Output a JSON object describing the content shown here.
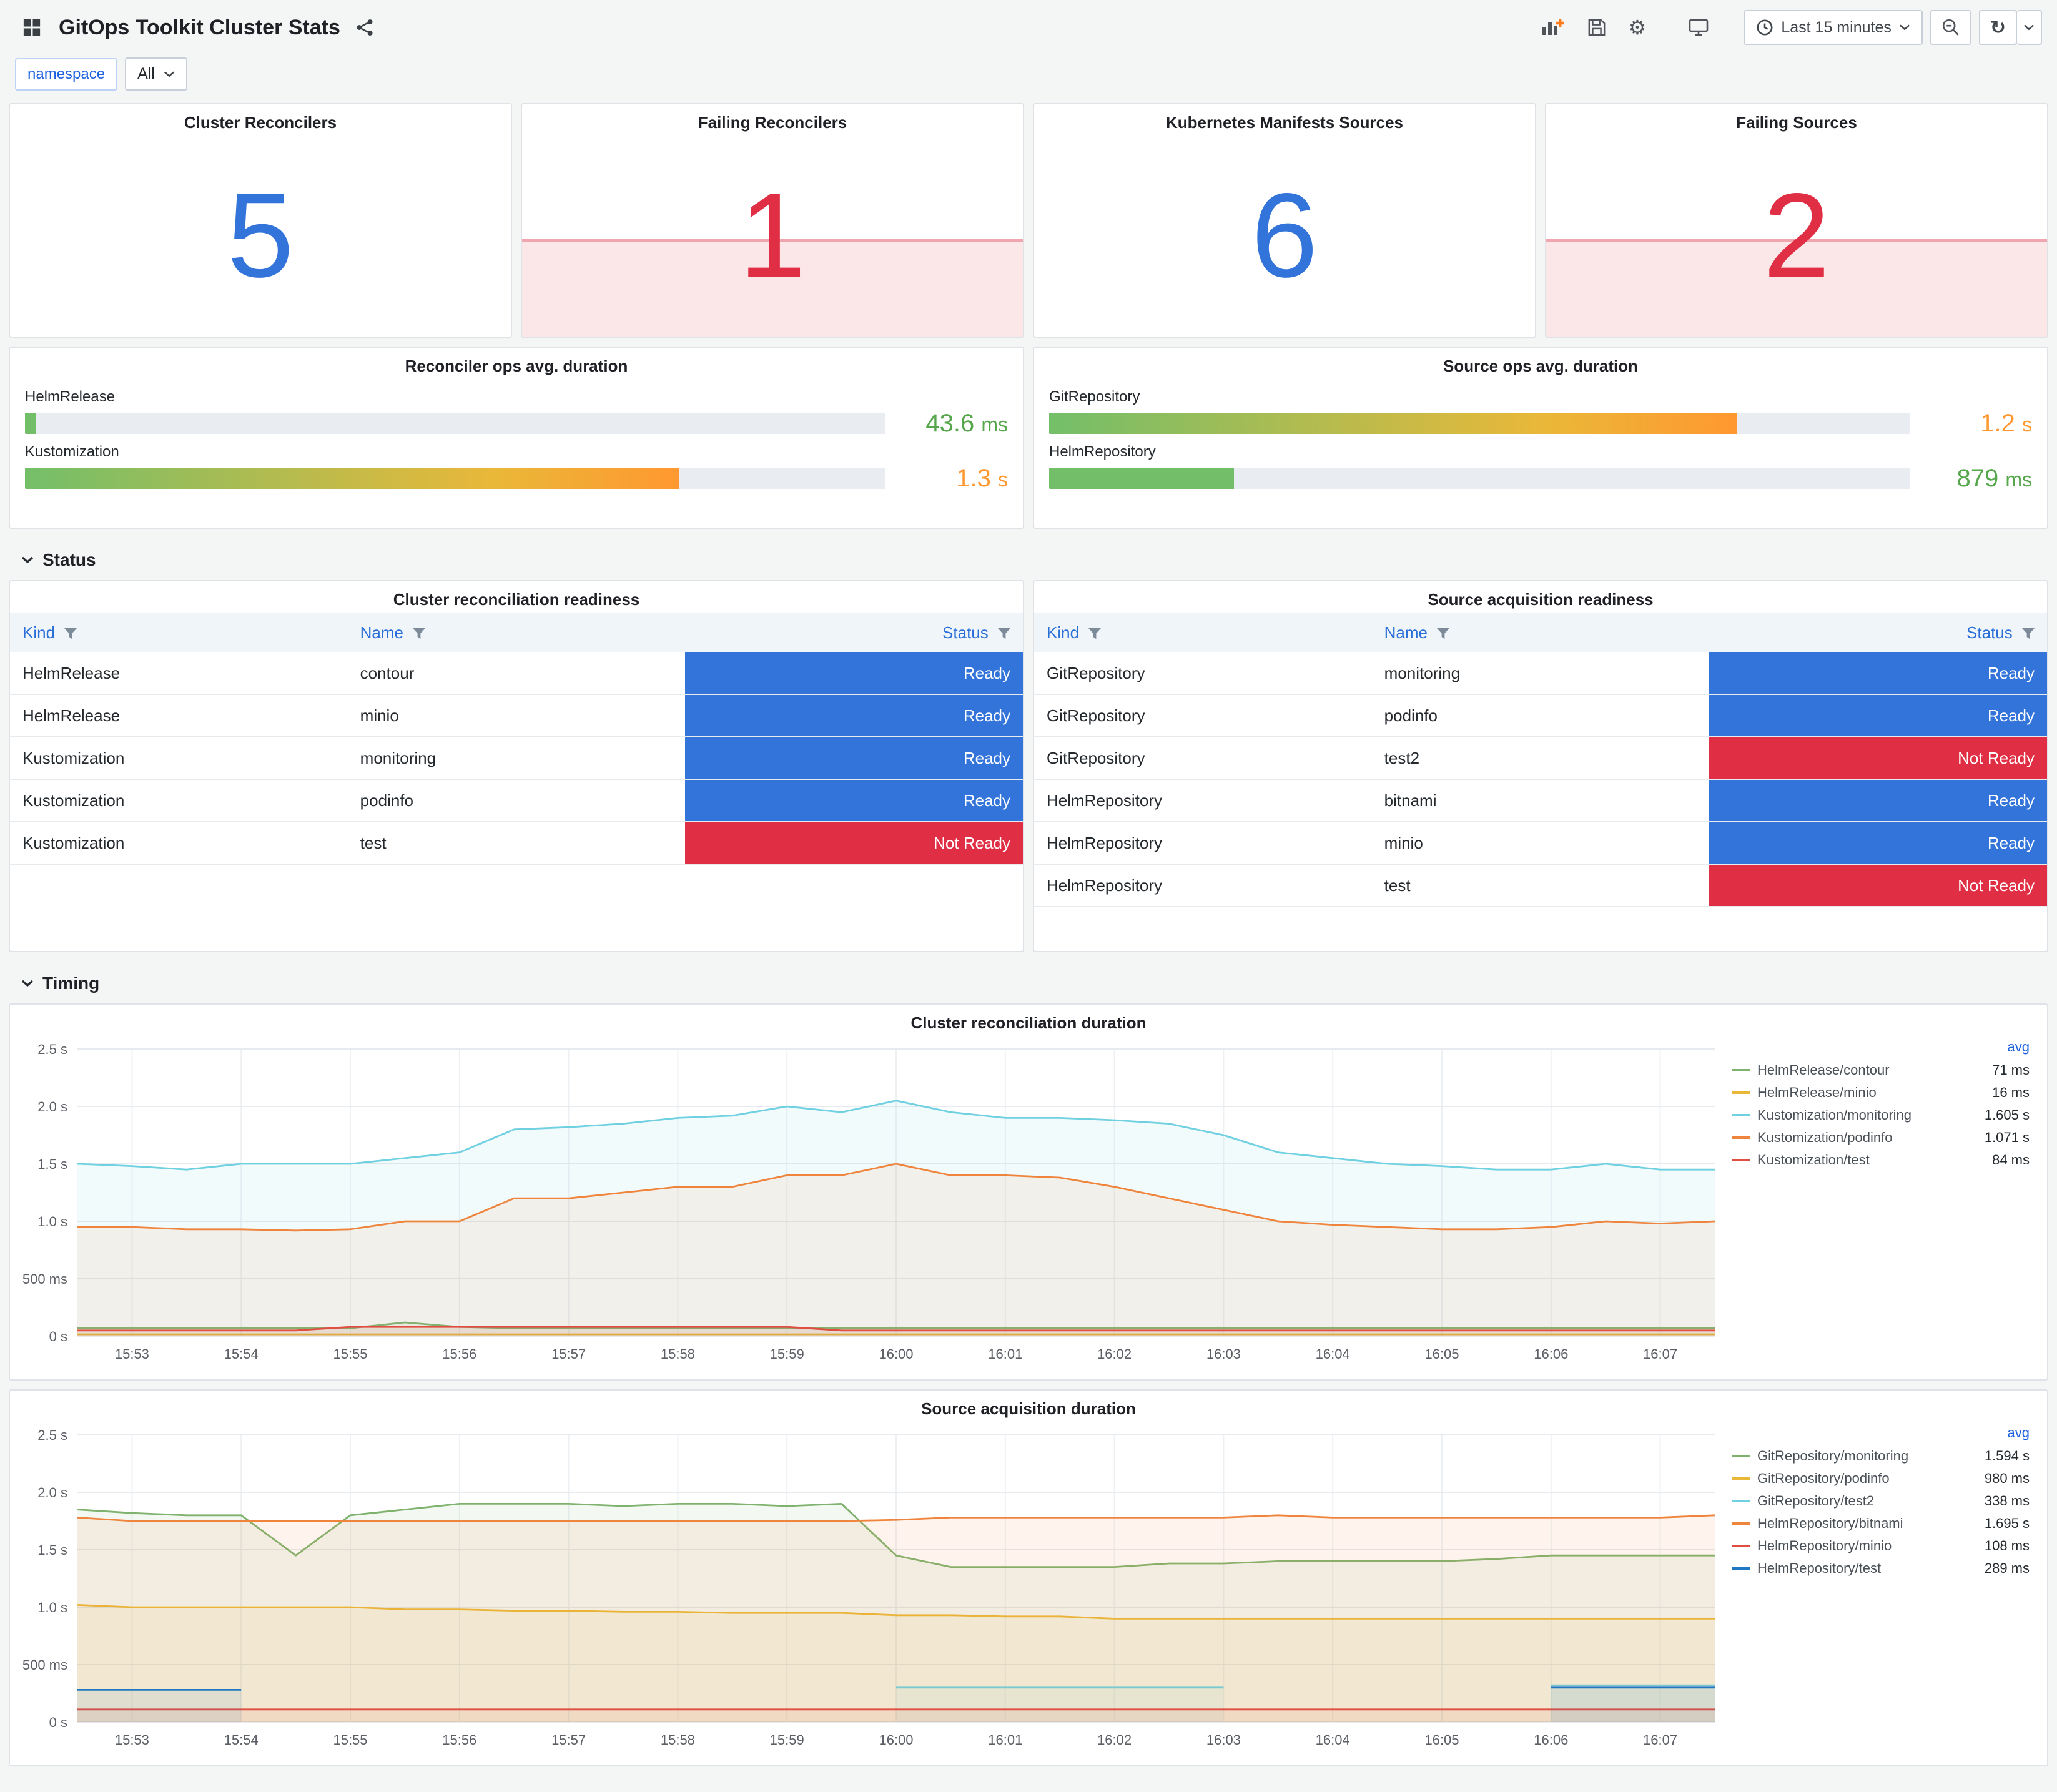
{
  "header": {
    "title": "GitOps Toolkit Cluster Stats",
    "time_range": "Last 15 minutes"
  },
  "filters": {
    "namespace_label": "namespace",
    "namespace_value": "All"
  },
  "sections": {
    "status": "Status",
    "timing": "Timing"
  },
  "stats": [
    {
      "title": "Cluster Reconcilers",
      "value": "5",
      "state": "ok"
    },
    {
      "title": "Failing Reconcilers",
      "value": "1",
      "state": "alert"
    },
    {
      "title": "Kubernetes Manifests Sources",
      "value": "6",
      "state": "ok"
    },
    {
      "title": "Failing Sources",
      "value": "2",
      "state": "alert"
    }
  ],
  "gauges": [
    {
      "title": "Reconciler ops avg. duration",
      "bars": [
        {
          "label": "HelmRelease",
          "value": "43.6",
          "unit": "ms",
          "fraction": 0.013,
          "color": "green"
        },
        {
          "label": "Kustomization",
          "value": "1.3",
          "unit": "s",
          "fraction": 0.76,
          "color": "orange"
        }
      ]
    },
    {
      "title": "Source ops avg. duration",
      "bars": [
        {
          "label": "GitRepository",
          "value": "1.2",
          "unit": "s",
          "fraction": 0.8,
          "color": "orange"
        },
        {
          "label": "HelmRepository",
          "value": "879",
          "unit": "ms",
          "fraction": 0.215,
          "color": "green"
        }
      ]
    }
  ],
  "tables": [
    {
      "title": "Cluster reconciliation readiness",
      "columns": [
        "Kind",
        "Name",
        "Status"
      ],
      "rows": [
        [
          "HelmRelease",
          "contour",
          "Ready"
        ],
        [
          "HelmRelease",
          "minio",
          "Ready"
        ],
        [
          "Kustomization",
          "monitoring",
          "Ready"
        ],
        [
          "Kustomization",
          "podinfo",
          "Ready"
        ],
        [
          "Kustomization",
          "test",
          "Not Ready"
        ]
      ]
    },
    {
      "title": "Source acquisition readiness",
      "columns": [
        "Kind",
        "Name",
        "Status"
      ],
      "rows": [
        [
          "GitRepository",
          "monitoring",
          "Ready"
        ],
        [
          "GitRepository",
          "podinfo",
          "Ready"
        ],
        [
          "GitRepository",
          "test2",
          "Not Ready"
        ],
        [
          "HelmRepository",
          "bitnami",
          "Ready"
        ],
        [
          "HelmRepository",
          "minio",
          "Ready"
        ],
        [
          "HelmRepository",
          "test",
          "Not Ready"
        ]
      ]
    }
  ],
  "chart_data": [
    {
      "type": "line",
      "title": "Cluster reconciliation duration",
      "legend_header": "avg",
      "ylim": [
        0,
        2.5
      ],
      "yticks": [
        {
          "v": 0,
          "label": "0 s"
        },
        {
          "v": 0.5,
          "label": "500 ms"
        },
        {
          "v": 1.0,
          "label": "1.0 s"
        },
        {
          "v": 1.5,
          "label": "1.5 s"
        },
        {
          "v": 2.0,
          "label": "2.0 s"
        },
        {
          "v": 2.5,
          "label": "2.5 s"
        }
      ],
      "x": [
        "15:53",
        "15:54",
        "15:55",
        "15:56",
        "15:57",
        "15:58",
        "15:59",
        "16:00",
        "16:01",
        "16:02",
        "16:03",
        "16:04",
        "16:05",
        "16:06",
        "16:07"
      ],
      "series": [
        {
          "name": "HelmRelease/contour",
          "avg": "71 ms",
          "color": "#7EB26D",
          "values": [
            0.07,
            0.07,
            0.07,
            0.07,
            0.07,
            0.07,
            0.12,
            0.08,
            0.07,
            0.07,
            0.07,
            0.07,
            0.07,
            0.07,
            0.07,
            0.07,
            0.07,
            0.07,
            0.07,
            0.07,
            0.07,
            0.07,
            0.07,
            0.07,
            0.07,
            0.07,
            0.07,
            0.07,
            0.07,
            0.07,
            0.07
          ]
        },
        {
          "name": "HelmRelease/minio",
          "avg": "16 ms",
          "color": "#EAB839",
          "values": [
            0.016,
            0.016,
            0.016,
            0.016,
            0.016,
            0.016,
            0.016,
            0.016,
            0.016,
            0.016,
            0.016,
            0.016,
            0.016,
            0.016,
            0.016,
            0.016,
            0.016,
            0.016,
            0.016,
            0.016,
            0.016,
            0.016,
            0.016,
            0.016,
            0.016,
            0.016,
            0.016,
            0.016,
            0.016,
            0.016,
            0.016
          ]
        },
        {
          "name": "Kustomization/monitoring",
          "avg": "1.605 s",
          "color": "#6ED0E0",
          "values": [
            1.5,
            1.48,
            1.45,
            1.5,
            1.5,
            1.5,
            1.55,
            1.6,
            1.8,
            1.82,
            1.85,
            1.9,
            1.92,
            2.0,
            1.95,
            2.05,
            1.95,
            1.9,
            1.9,
            1.88,
            1.85,
            1.75,
            1.6,
            1.55,
            1.5,
            1.48,
            1.45,
            1.45,
            1.5,
            1.45,
            1.45
          ]
        },
        {
          "name": "Kustomization/podinfo",
          "avg": "1.071 s",
          "color": "#EF843C",
          "values": [
            0.95,
            0.95,
            0.93,
            0.93,
            0.92,
            0.93,
            1.0,
            1.0,
            1.2,
            1.2,
            1.25,
            1.3,
            1.3,
            1.4,
            1.4,
            1.5,
            1.4,
            1.4,
            1.38,
            1.3,
            1.2,
            1.1,
            1.0,
            0.97,
            0.95,
            0.93,
            0.93,
            0.95,
            1.0,
            0.98,
            1.0
          ]
        },
        {
          "name": "Kustomization/test",
          "avg": "84 ms",
          "color": "#E24D42",
          "values": [
            0.05,
            0.05,
            0.05,
            0.05,
            0.05,
            0.08,
            0.08,
            0.08,
            0.08,
            0.08,
            0.08,
            0.08,
            0.08,
            0.08,
            0.05,
            0.05,
            0.05,
            0.05,
            0.05,
            0.05,
            0.05,
            0.05,
            0.05,
            0.05,
            0.05,
            0.05,
            0.05,
            0.05,
            0.05,
            0.05,
            0.05
          ]
        }
      ]
    },
    {
      "type": "line",
      "title": "Source acquisition duration",
      "legend_header": "avg",
      "ylim": [
        0,
        2.5
      ],
      "yticks": [
        {
          "v": 0,
          "label": "0 s"
        },
        {
          "v": 0.5,
          "label": "500 ms"
        },
        {
          "v": 1.0,
          "label": "1.0 s"
        },
        {
          "v": 1.5,
          "label": "1.5 s"
        },
        {
          "v": 2.0,
          "label": "2.0 s"
        },
        {
          "v": 2.5,
          "label": "2.5 s"
        }
      ],
      "x": [
        "15:53",
        "15:54",
        "15:55",
        "15:56",
        "15:57",
        "15:58",
        "15:59",
        "16:00",
        "16:01",
        "16:02",
        "16:03",
        "16:04",
        "16:05",
        "16:06",
        "16:07"
      ],
      "series": [
        {
          "name": "GitRepository/monitoring",
          "avg": "1.594 s",
          "color": "#7EB26D",
          "values": [
            1.85,
            1.82,
            1.8,
            1.8,
            1.45,
            1.8,
            1.85,
            1.9,
            1.9,
            1.9,
            1.88,
            1.9,
            1.9,
            1.88,
            1.9,
            1.45,
            1.35,
            1.35,
            1.35,
            1.35,
            1.38,
            1.38,
            1.4,
            1.4,
            1.4,
            1.4,
            1.42,
            1.45,
            1.45,
            1.45,
            1.45
          ]
        },
        {
          "name": "GitRepository/podinfo",
          "avg": "980 ms",
          "color": "#EAB839",
          "values": [
            1.02,
            1.0,
            1.0,
            1.0,
            1.0,
            1.0,
            0.98,
            0.98,
            0.97,
            0.97,
            0.96,
            0.96,
            0.95,
            0.95,
            0.95,
            0.93,
            0.93,
            0.92,
            0.92,
            0.9,
            0.9,
            0.9,
            0.9,
            0.9,
            0.9,
            0.9,
            0.9,
            0.9,
            0.9,
            0.9,
            0.9
          ]
        },
        {
          "name": "GitRepository/test2",
          "avg": "338 ms",
          "color": "#6ED0E0",
          "values": [
            null,
            null,
            null,
            null,
            null,
            null,
            null,
            null,
            null,
            null,
            null,
            null,
            null,
            null,
            null,
            0.3,
            0.3,
            0.3,
            0.3,
            0.3,
            0.3,
            0.3,
            null,
            null,
            null,
            null,
            null,
            0.32,
            0.32,
            0.32,
            0.32
          ]
        },
        {
          "name": "HelmRepository/bitnami",
          "avg": "1.695 s",
          "color": "#EF843C",
          "values": [
            1.78,
            1.75,
            1.75,
            1.75,
            1.75,
            1.75,
            1.75,
            1.75,
            1.75,
            1.75,
            1.75,
            1.75,
            1.75,
            1.75,
            1.75,
            1.76,
            1.78,
            1.78,
            1.78,
            1.78,
            1.78,
            1.78,
            1.8,
            1.78,
            1.78,
            1.78,
            1.78,
            1.78,
            1.78,
            1.78,
            1.8
          ]
        },
        {
          "name": "HelmRepository/minio",
          "avg": "108 ms",
          "color": "#E24D42",
          "values": [
            0.11,
            0.11,
            0.11,
            0.11,
            0.11,
            0.11,
            0.11,
            0.11,
            0.11,
            0.11,
            0.11,
            0.11,
            0.11,
            0.11,
            0.11,
            0.11,
            0.11,
            0.11,
            0.11,
            0.11,
            0.11,
            0.11,
            0.11,
            0.11,
            0.11,
            0.11,
            0.11,
            0.11,
            0.11,
            0.11,
            0.11
          ]
        },
        {
          "name": "HelmRepository/test",
          "avg": "289 ms",
          "color": "#1F78C1",
          "values": [
            0.28,
            0.28,
            0.28,
            0.28,
            null,
            null,
            null,
            null,
            null,
            null,
            null,
            null,
            null,
            null,
            null,
            null,
            null,
            null,
            null,
            null,
            null,
            null,
            null,
            null,
            null,
            null,
            null,
            0.3,
            0.3,
            0.3,
            0.3
          ]
        }
      ]
    }
  ],
  "colors": {
    "accent_blue": "#3274d9",
    "alert_red": "#e02f44",
    "band_bg": "rgba(224,47,68,0.12)",
    "band_border": "rgba(224,47,68,0.35)",
    "value_green": "#56a64b",
    "value_orange": "#ff9830",
    "gauge_green": "#73bf69",
    "gauge_yellow": "#eab839",
    "gauge_orange": "#ff9830",
    "legend_avg": "#1f62e0",
    "status": {
      "Ready": "#3274d9",
      "Not Ready": "#e02f44"
    }
  },
  "icons": {
    "settings": "⚙",
    "refresh": "↻"
  }
}
